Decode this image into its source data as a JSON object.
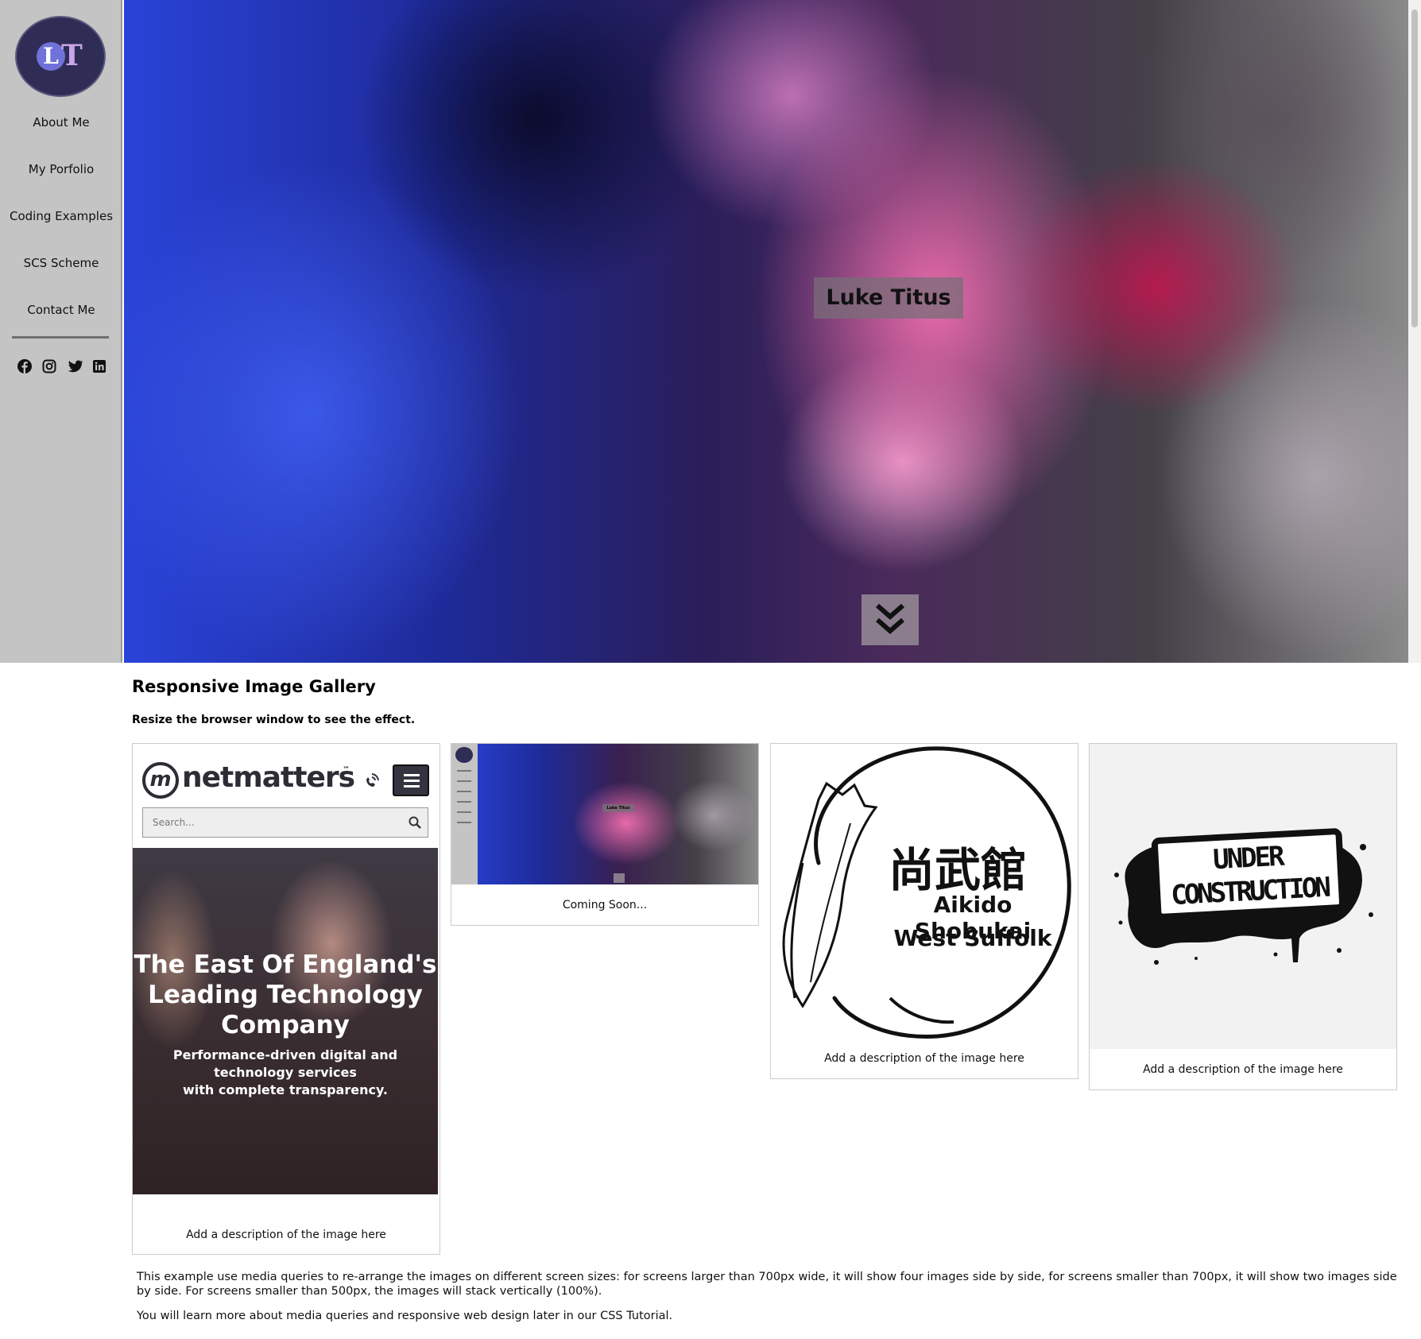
{
  "sidebar": {
    "logo_text": {
      "l": "L",
      "t": "T"
    },
    "items": [
      {
        "label": "About Me"
      },
      {
        "label": "My Porfolio"
      },
      {
        "label": "Coding Examples"
      },
      {
        "label": "SCS Scheme"
      },
      {
        "label": "Contact Me"
      }
    ],
    "social_icons": [
      "facebook-icon",
      "instagram-icon",
      "twitter-icon",
      "linkedin-icon"
    ]
  },
  "hero": {
    "title": "Luke Titus",
    "scroll_icon": "double-chevron-down-icon"
  },
  "gallery": {
    "title": "Responsive Image Gallery",
    "subtitle": "Resize the browser window to see the effect.",
    "cards": [
      {
        "description": "Add a description of the image here",
        "image": {
          "brand": "netmatters",
          "trademark": "™",
          "search_placeholder": "Search...",
          "headline": "The East Of England's Leading Technology Company",
          "tagline_1": "Performance-driven digital and",
          "tagline_2": "technology services",
          "tagline_3": "with complete transparency."
        }
      },
      {
        "description": "Coming Soon...",
        "image": {
          "title": "Luke Titus"
        }
      },
      {
        "description": "Add a description of the image here",
        "image": {
          "kanji": "尚武館",
          "line_1": "Aikido Shobukai",
          "line_2": "West Suffolk"
        }
      },
      {
        "description": "Add a description of the image here",
        "image": {
          "line_1": "UNDER",
          "line_2": "CONSTRUCTION"
        }
      }
    ]
  },
  "footer": {
    "paragraph_1": "This example use media queries to re-arrange the images on different screen sizes: for screens larger than 700px wide, it will show four images side by side, for screens smaller than 700px, it will show two images side by side. For screens smaller than 500px, the images will stack vertically (100%).",
    "paragraph_2": "You will learn more about media queries and responsive web design later in our CSS Tutorial."
  },
  "colors": {
    "sidebar_bg": "#c4c4c4",
    "logo_bg": "#2f2c56",
    "title_box": "#786e78"
  }
}
